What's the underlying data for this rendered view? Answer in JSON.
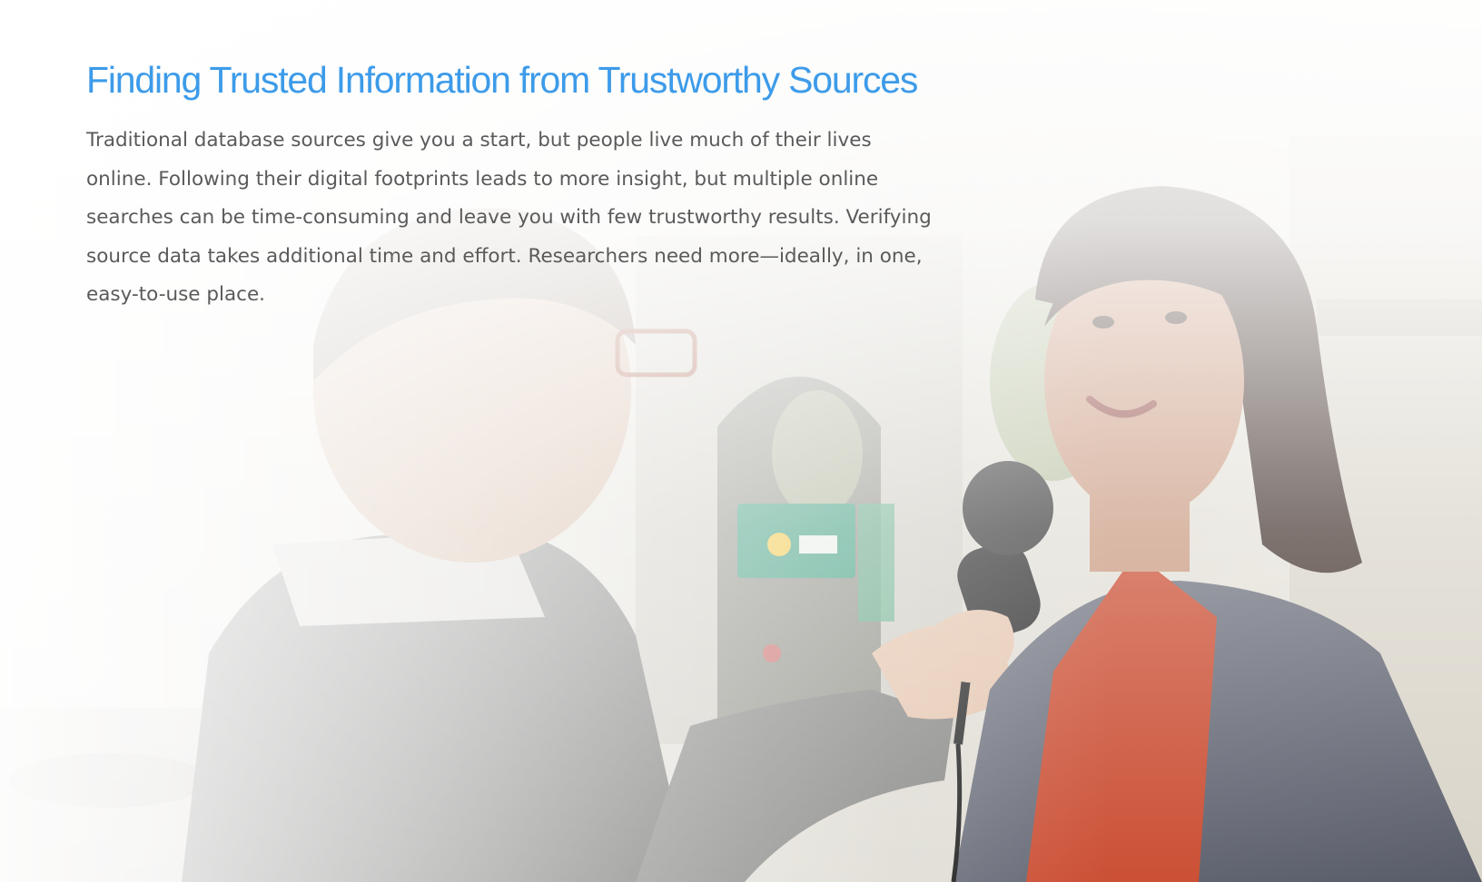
{
  "hero": {
    "title": "Finding Trusted Information from Trustworthy Sources",
    "body": "Traditional database sources give you a start, but people live much of their lives online. Following their digital footprints leads to more insight, but multiple online searches can be time-consuming and leave you with few trustworthy results. Verifying source data takes additional time and effort. Researchers need more—ideally, in one, easy-to-use place.",
    "colors": {
      "title": "#3d9be9",
      "body": "#5a5a5a"
    }
  }
}
